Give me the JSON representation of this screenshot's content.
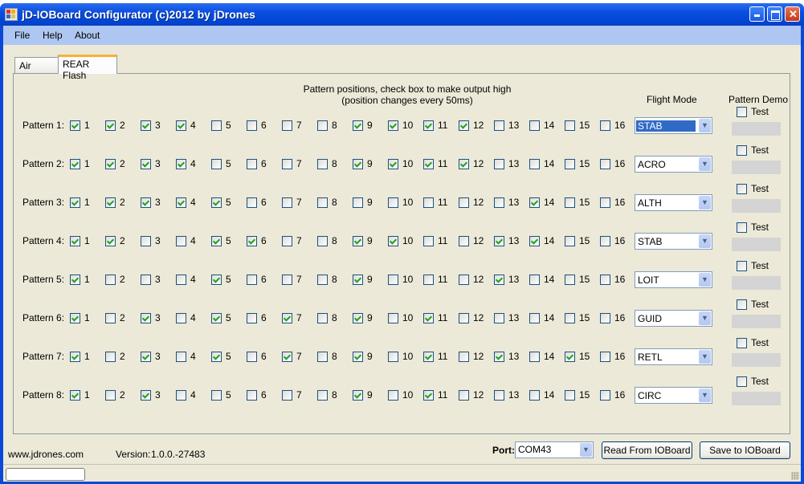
{
  "window": {
    "title": "jD-IOBoard Configurator (c)2012 by jDrones",
    "icon": "app-icon",
    "controls": {
      "minimize": "_",
      "maximize": "□",
      "close": "✕"
    }
  },
  "menu": [
    "File",
    "Help",
    "About"
  ],
  "tabs": [
    {
      "label": "Air Frame",
      "active": false
    },
    {
      "label": "REAR Flash",
      "active": true
    }
  ],
  "rear_flash": {
    "header_line1": "Pattern positions, check box to make output high",
    "header_line2": "(position changes every 50ms)",
    "flight_mode_header": "Flight Mode",
    "pattern_demo_header": "Pattern Demo",
    "test_label": "Test",
    "position_labels": [
      "1",
      "2",
      "3",
      "4",
      "5",
      "6",
      "7",
      "8",
      "9",
      "10",
      "11",
      "12",
      "13",
      "14",
      "15",
      "16"
    ],
    "patterns": [
      {
        "label": "Pattern 1:",
        "checked": [
          1,
          2,
          3,
          4,
          9,
          10,
          11,
          12
        ],
        "flight_mode": "STAB",
        "test": false
      },
      {
        "label": "Pattern 2:",
        "checked": [
          1,
          2,
          3,
          4,
          9,
          10,
          11,
          12
        ],
        "flight_mode": "ACRO",
        "test": false
      },
      {
        "label": "Pattern 3:",
        "checked": [
          1,
          2,
          3,
          4,
          5,
          14
        ],
        "flight_mode": "ALTH",
        "test": false
      },
      {
        "label": "Pattern 4:",
        "checked": [
          1,
          2,
          5,
          6,
          9,
          10,
          13,
          14
        ],
        "flight_mode": "STAB",
        "test": false
      },
      {
        "label": "Pattern 5:",
        "checked": [
          1,
          5,
          9,
          13
        ],
        "flight_mode": "LOIT",
        "test": false
      },
      {
        "label": "Pattern 6:",
        "checked": [
          1,
          3,
          5,
          7,
          9,
          11
        ],
        "flight_mode": "GUID",
        "test": false
      },
      {
        "label": "Pattern 7:",
        "checked": [
          1,
          3,
          5,
          7,
          9,
          11,
          13,
          15
        ],
        "flight_mode": "RETL",
        "test": false
      },
      {
        "label": "Pattern 8:",
        "checked": [
          1,
          3,
          9,
          11
        ],
        "flight_mode": "CIRC",
        "test": false
      }
    ]
  },
  "footer": {
    "website": "www.jdrones.com",
    "version_label": "Version:",
    "version": "1.0.0.-27483",
    "port_label": "Port:",
    "port_value": "COM43",
    "read_button": "Read From IOBoard",
    "save_button": "Save to IOBoard"
  },
  "status": {
    "progress": 0
  }
}
